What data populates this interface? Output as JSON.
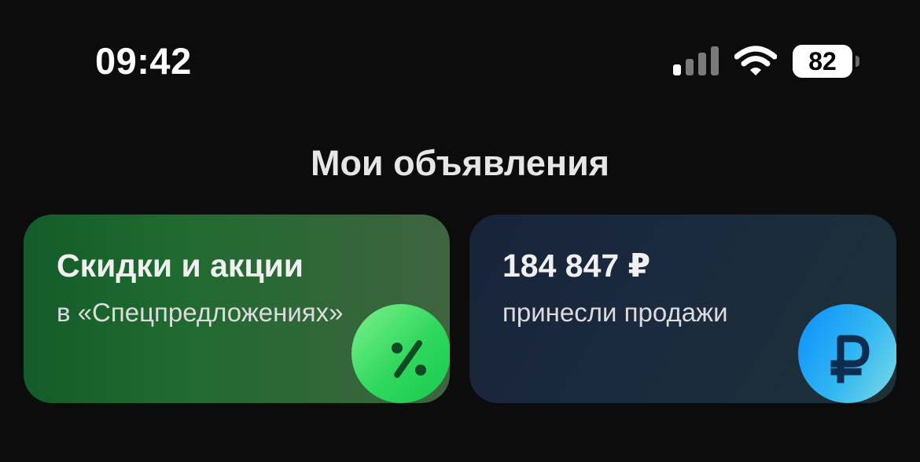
{
  "status_bar": {
    "time": "09:42",
    "battery_level": "82"
  },
  "page": {
    "title": "Мои объявления"
  },
  "cards": {
    "promo": {
      "title": "Скидки и акции",
      "subtitle": "в «Спецпредложе­ниях»",
      "icon": "percent-icon"
    },
    "sales": {
      "title": "184 847 ₽",
      "subtitle": "принесли продажи",
      "icon": "ruble-icon"
    }
  },
  "colors": {
    "background": "#0c0c0c",
    "promo_accent": "#2fd85c",
    "sales_accent": "#0a8dff"
  }
}
